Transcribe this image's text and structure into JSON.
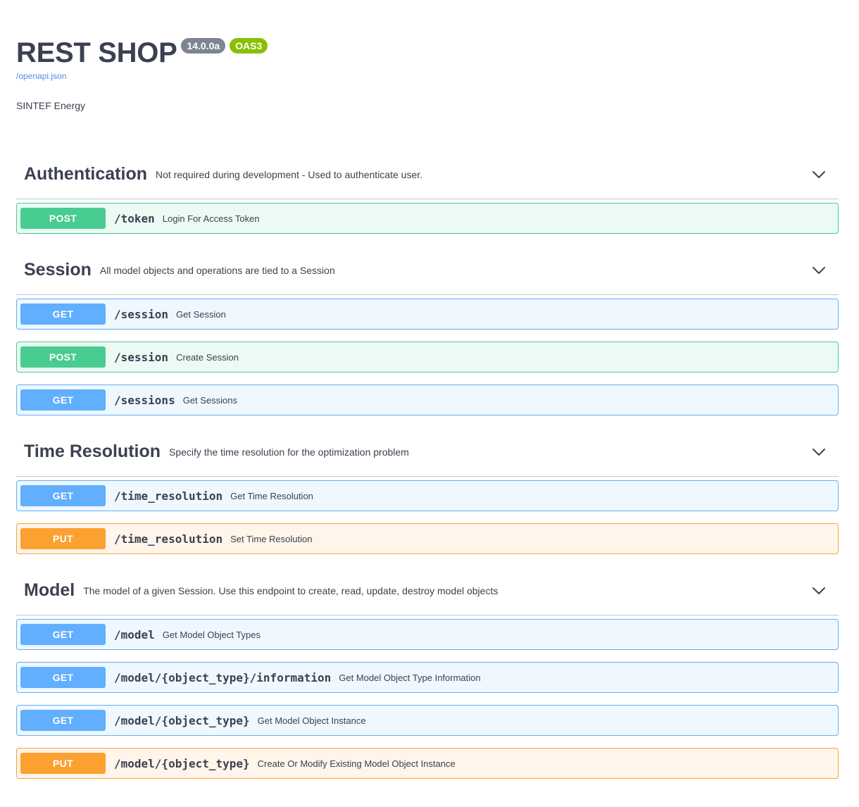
{
  "info": {
    "title": "REST SHOP",
    "version": "14.0.0a",
    "oas": "OAS3",
    "spec_link": "/openapi.json",
    "description": "SINTEF Energy"
  },
  "tags": [
    {
      "name": "Authentication",
      "description": "Not required during development - Used to authenticate user.",
      "ops": [
        {
          "method": "POST",
          "path": "/token",
          "summary": "Login For Access Token"
        }
      ]
    },
    {
      "name": "Session",
      "description": "All model objects and operations are tied to a Session",
      "ops": [
        {
          "method": "GET",
          "path": "/session",
          "summary": "Get Session"
        },
        {
          "method": "POST",
          "path": "/session",
          "summary": "Create Session"
        },
        {
          "method": "GET",
          "path": "/sessions",
          "summary": "Get Sessions"
        }
      ]
    },
    {
      "name": "Time Resolution",
      "description": "Specify the time resolution for the optimization problem",
      "ops": [
        {
          "method": "GET",
          "path": "/time_resolution",
          "summary": "Get Time Resolution"
        },
        {
          "method": "PUT",
          "path": "/time_resolution",
          "summary": "Set Time Resolution"
        }
      ]
    },
    {
      "name": "Model",
      "description": "The model of a given Session. Use this endpoint to create, read, update, destroy model objects",
      "ops": [
        {
          "method": "GET",
          "path": "/model",
          "summary": "Get Model Object Types"
        },
        {
          "method": "GET",
          "path": "/model/{object_type}/information",
          "summary": "Get Model Object Type Information"
        },
        {
          "method": "GET",
          "path": "/model/{object_type}",
          "summary": "Get Model Object Instance"
        },
        {
          "method": "PUT",
          "path": "/model/{object_type}",
          "summary": "Create Or Modify Existing Model Object Instance"
        }
      ]
    }
  ],
  "icons": {
    "chevron": "chevron-down-icon"
  }
}
